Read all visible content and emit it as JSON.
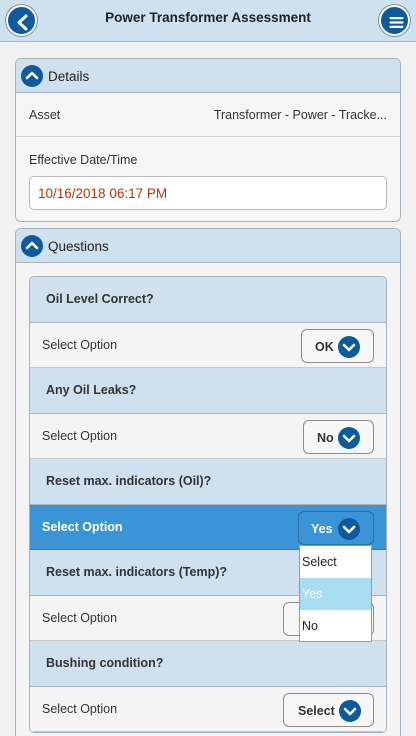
{
  "header": {
    "title": "Power Transformer Assessment"
  },
  "details": {
    "title": "Details",
    "asset_label": "Asset",
    "asset_value": "Transformer - Power - Tracke...",
    "date_label": "Effective Date/Time",
    "date_value": "10/16/2018 06:17 PM"
  },
  "questions": {
    "title": "Questions",
    "items": [
      {
        "question": "Oil Level Correct?",
        "option_label": "Select Option",
        "value": "OK"
      },
      {
        "question": "Any Oil Leaks?",
        "option_label": "Select Option",
        "value": "No"
      },
      {
        "question": "Reset max. indicators (Oil)?",
        "option_label": "Select Option",
        "value": "Yes"
      },
      {
        "question": "Reset max. indicators (Temp)?",
        "option_label": "Select Option",
        "value": ""
      },
      {
        "question": "Bushing condition?",
        "option_label": "Select Option",
        "value": "Select"
      }
    ]
  },
  "dropdown": {
    "options": [
      "Select",
      "Yes",
      "No"
    ],
    "highlighted": "Yes"
  },
  "colors": {
    "accent": "#0e5a9e",
    "header_bg": "#cfe0ef",
    "active_row": "#3b94d5",
    "date_text": "#b4330f",
    "highlight": "#a8dcf1"
  }
}
